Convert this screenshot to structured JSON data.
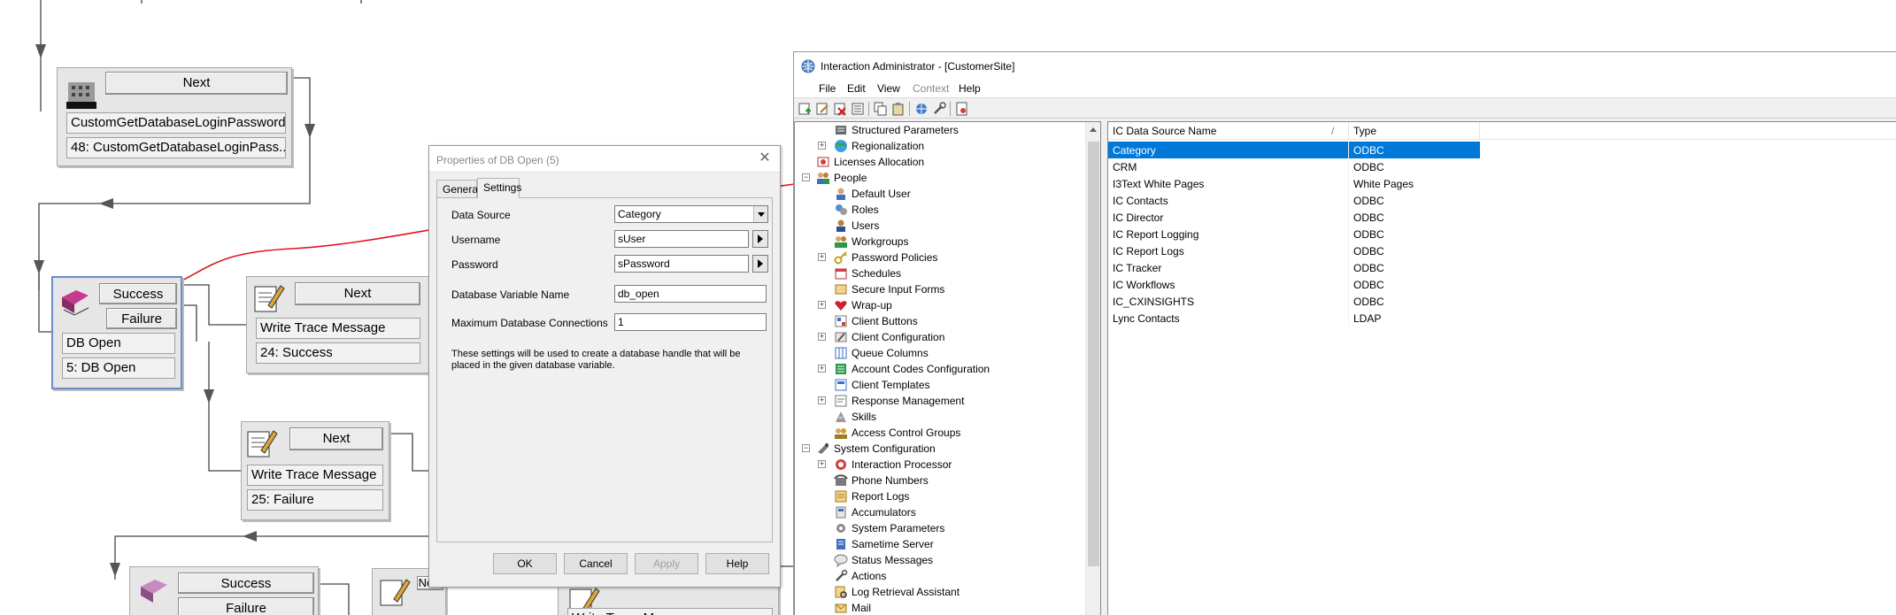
{
  "flow": {
    "node1": {
      "exit": "Next",
      "name": "CustomGetDatabaseLoginPassword",
      "id": "48: CustomGetDatabaseLoginPass..."
    },
    "node2": {
      "exit_success": "Success",
      "exit_failure": "Failure",
      "name": "DB Open",
      "id": "5: DB Open"
    },
    "node3": {
      "exit": "Next",
      "name": "Write Trace Message",
      "id": "24: Success"
    },
    "node4": {
      "exit": "Next",
      "name": "Write Trace Message",
      "id": "25: Failure"
    },
    "node5": {
      "exit_success": "Success",
      "exit_failure": "Failure"
    },
    "node6": {
      "exit": "Next"
    },
    "node7": {
      "name": "Write Trace Message"
    }
  },
  "dialog": {
    "title": "Properties of DB Open (5)",
    "tabs": [
      {
        "label": "General"
      },
      {
        "label": "Settings"
      }
    ],
    "fields": {
      "data_source_label": "Data Source",
      "data_source_value": "Category",
      "username_label": "Username",
      "username_value": "sUser",
      "password_label": "Password",
      "password_value": "sPassword",
      "db_var_label": "Database Variable Name",
      "db_var_value": "db_open",
      "max_conn_label": "Maximum Database Connections",
      "max_conn_value": "1"
    },
    "note": "These settings will be used to create a database handle that will be placed in the given database variable.",
    "buttons": {
      "ok": "OK",
      "cancel": "Cancel",
      "apply": "Apply",
      "help": "Help"
    }
  },
  "admin": {
    "title": "Interaction Administrator - [CustomerSite]",
    "menu": [
      "File",
      "Edit",
      "View",
      "Context",
      "Help"
    ],
    "tree": [
      {
        "label": "Structured Parameters"
      },
      {
        "label": "Regionalization"
      },
      {
        "label": "Licenses Allocation"
      },
      {
        "label": "People"
      },
      {
        "label": "Default User"
      },
      {
        "label": "Roles"
      },
      {
        "label": "Users"
      },
      {
        "label": "Workgroups"
      },
      {
        "label": "Password Policies"
      },
      {
        "label": "Schedules"
      },
      {
        "label": "Secure Input Forms"
      },
      {
        "label": "Wrap-up"
      },
      {
        "label": "Client Buttons"
      },
      {
        "label": "Client Configuration"
      },
      {
        "label": "Queue Columns"
      },
      {
        "label": "Account Codes Configuration"
      },
      {
        "label": "Client Templates"
      },
      {
        "label": "Response Management"
      },
      {
        "label": "Skills"
      },
      {
        "label": "Access Control Groups"
      },
      {
        "label": "System Configuration"
      },
      {
        "label": "Interaction Processor"
      },
      {
        "label": "Phone Numbers"
      },
      {
        "label": "Report Logs"
      },
      {
        "label": "Accumulators"
      },
      {
        "label": "System Parameters"
      },
      {
        "label": "Sametime Server"
      },
      {
        "label": "Status Messages"
      },
      {
        "label": "Actions"
      },
      {
        "label": "Log Retrieval Assistant"
      },
      {
        "label": "Mail"
      }
    ],
    "list": {
      "headers": {
        "name": "IC Data Source Name",
        "sort": "/",
        "type": "Type"
      },
      "rows": [
        {
          "name": "Category",
          "type": "ODBC"
        },
        {
          "name": "CRM",
          "type": "ODBC"
        },
        {
          "name": "I3Text White Pages",
          "type": "White Pages"
        },
        {
          "name": "IC Contacts",
          "type": "ODBC"
        },
        {
          "name": "IC Director",
          "type": "ODBC"
        },
        {
          "name": "IC Report Logging",
          "type": "ODBC"
        },
        {
          "name": "IC Report Logs",
          "type": "ODBC"
        },
        {
          "name": "IC Tracker",
          "type": "ODBC"
        },
        {
          "name": "IC Workflows",
          "type": "ODBC"
        },
        {
          "name": "IC_CXINSIGHTS",
          "type": "ODBC"
        },
        {
          "name": "Lync Contacts",
          "type": "LDAP"
        }
      ]
    }
  }
}
